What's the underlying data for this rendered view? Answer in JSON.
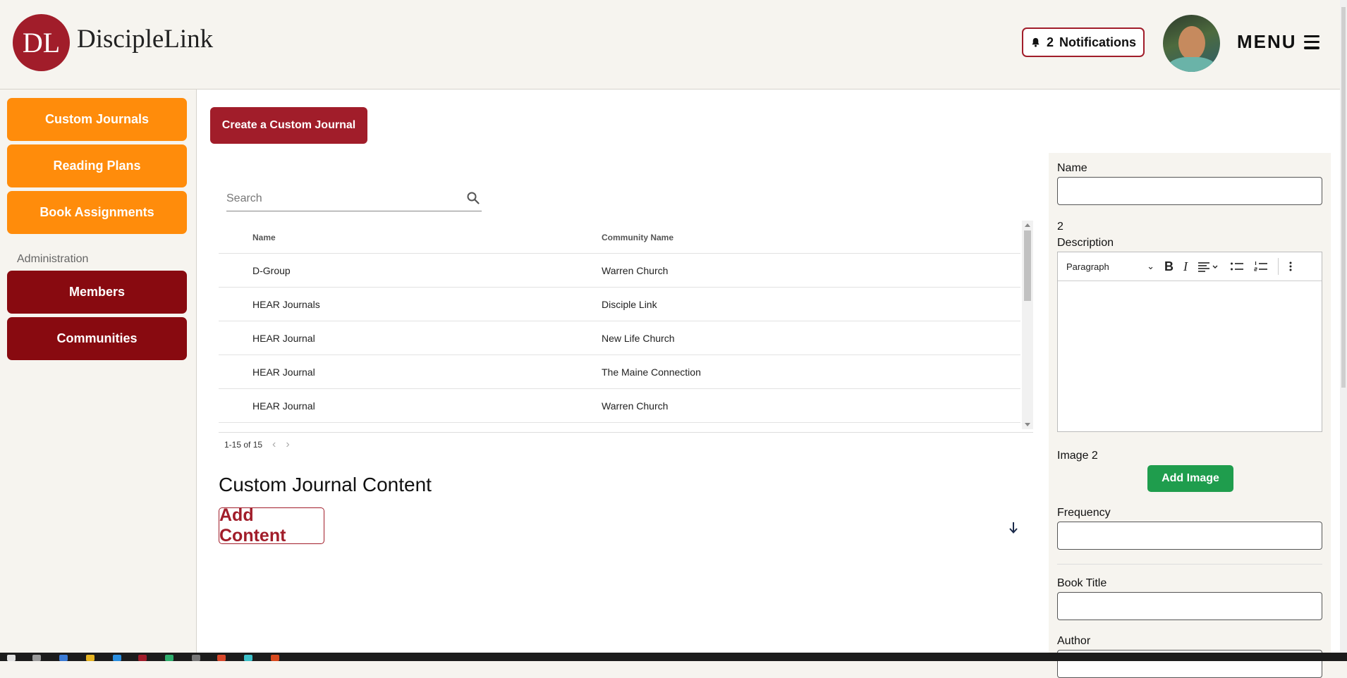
{
  "header": {
    "logo_mark": "DL",
    "logo_text": "DiscipleLink",
    "notifications_count": "2",
    "notifications_label": "Notifications",
    "menu_label": "MENU"
  },
  "sidebar": {
    "items": [
      {
        "label": "Custom Journals",
        "color": "#ff8c0b"
      },
      {
        "label": "Reading Plans",
        "color": "#ff8c0b"
      },
      {
        "label": "Book Assignments",
        "color": "#ff8c0b"
      }
    ],
    "admin_label": "Administration",
    "admin_items": [
      {
        "label": "Members",
        "color": "#880a10"
      },
      {
        "label": "Communities",
        "color": "#880a10"
      }
    ]
  },
  "main": {
    "create_button": "Create a Custom Journal",
    "search_placeholder": "Search",
    "table": {
      "columns": [
        "Name",
        "Community Name"
      ],
      "rows": [
        [
          "D-Group",
          "Warren Church"
        ],
        [
          "HEAR Journals",
          "Disciple Link"
        ],
        [
          "HEAR Journal",
          "New Life Church"
        ],
        [
          "HEAR Journal",
          "The Maine Connection"
        ],
        [
          "HEAR Journal",
          "Warren Church"
        ]
      ]
    },
    "pagination": "1-15 of 15",
    "section_title": "Custom Journal Content",
    "add_content_button": "Add Content"
  },
  "form": {
    "name_label": "Name",
    "description_prefix": "2",
    "description_label": "Description",
    "editor": {
      "block_format": "Paragraph",
      "bold": "B",
      "italic": "I"
    },
    "image_label": "Image 2",
    "add_image_button": "Add Image",
    "frequency_label": "Frequency",
    "book_title_label": "Book Title",
    "author_label": "Author"
  },
  "colors": {
    "brand_red": "#a11d2a",
    "orange": "#ff8c0b",
    "dark_red": "#880a10",
    "green": "#1f9d4d"
  }
}
